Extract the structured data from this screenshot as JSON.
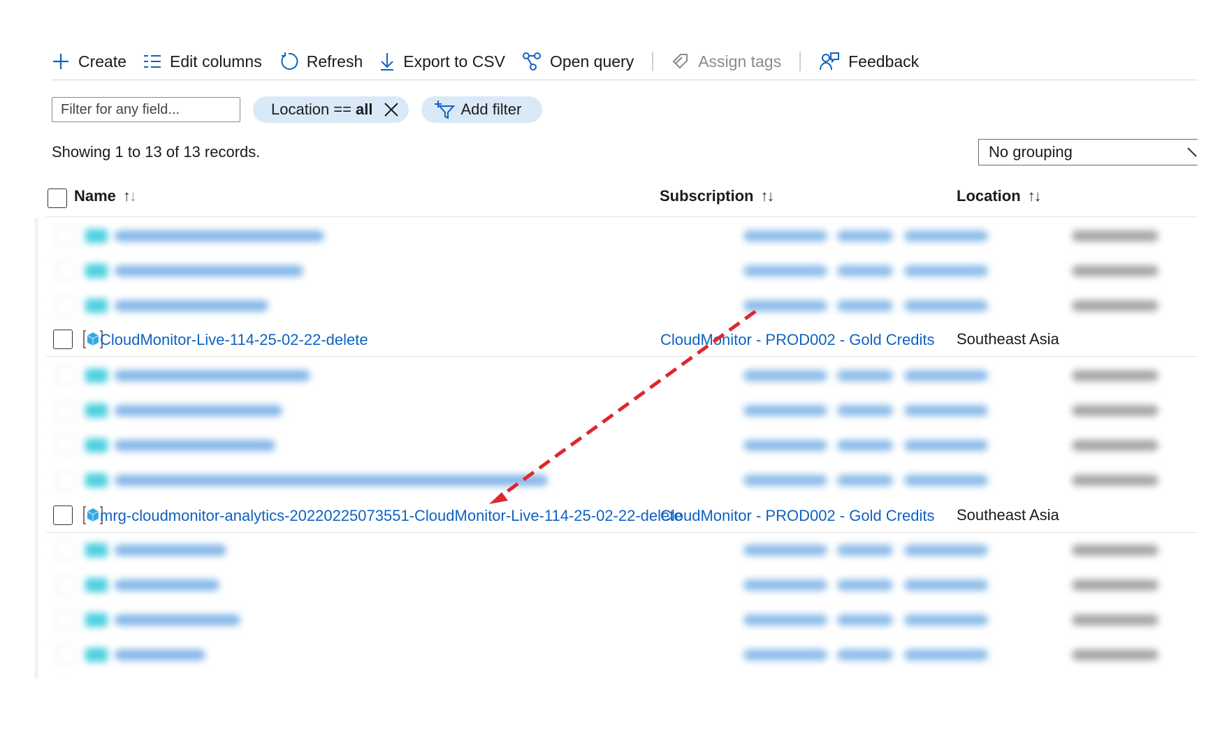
{
  "toolbar": {
    "create": "Create",
    "edit_columns": "Edit columns",
    "refresh": "Refresh",
    "export_csv": "Export to CSV",
    "open_query": "Open query",
    "assign_tags": "Assign tags",
    "feedback": "Feedback"
  },
  "filters": {
    "placeholder": "Filter for any field...",
    "location_prefix": "Location ==",
    "location_value": "all",
    "add_filter": "Add filter"
  },
  "records_text": "Showing 1 to 13 of 13 records.",
  "grouping": {
    "selected": "No grouping"
  },
  "columns": {
    "name": "Name",
    "subscription": "Subscription",
    "location": "Location",
    "sort_glyph": "↑↓"
  },
  "rows": [
    {
      "name": "CloudMonitor-Live-114-25-02-22-delete",
      "subscription": "CloudMonitor - PROD002 - Gold Credits",
      "location": "Southeast Asia"
    },
    {
      "name": "mrg-cloudmonitor-analytics-20220225073551-CloudMonitor-Live-114-25-02-22-delete",
      "subscription": "CloudMonitor - PROD002 - Gold Credits",
      "location": "Southeast Asia"
    }
  ],
  "annotation": {
    "color": "#e0262b"
  }
}
